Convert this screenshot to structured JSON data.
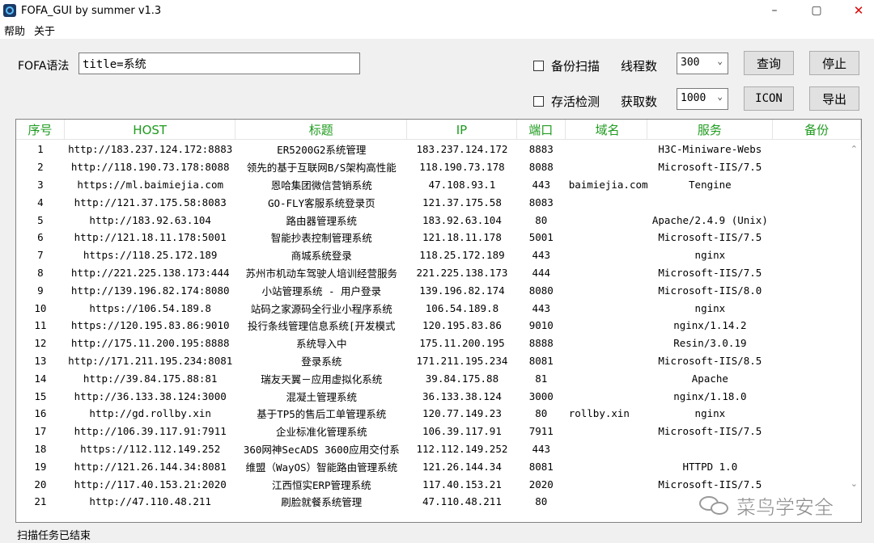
{
  "window": {
    "title": "FOFA_GUI  by summer v1.3",
    "min": "–",
    "max": "▢",
    "close": "✕"
  },
  "menu": {
    "items": [
      "帮助",
      "关于"
    ]
  },
  "query": {
    "label": "FOFA语法",
    "value": "title=系统",
    "backup_label": "备份扫描",
    "alive_label": "存活检测",
    "threads_label": "线程数",
    "threads_value": "300",
    "fetch_label": "获取数",
    "fetch_value": "1000",
    "query_btn": "查询",
    "stop_btn": "停止",
    "icon_btn": "ICON",
    "export_btn": "导出",
    "dropdown_arrow": "⌄"
  },
  "table": {
    "headers": [
      "序号",
      "HOST",
      "标题",
      "IP",
      "端口",
      "域名",
      "服务",
      "备份"
    ],
    "rows": [
      [
        "1",
        "http://183.237.124.172:8883",
        "ER5200G2系统管理",
        "183.237.124.172",
        "8883",
        "",
        "H3C-Miniware-Webs",
        ""
      ],
      [
        "2",
        "http://118.190.73.178:8088",
        "领先的基于互联网B/S架构高性能",
        "118.190.73.178",
        "8088",
        "",
        "Microsoft-IIS/7.5",
        ""
      ],
      [
        "3",
        "https://ml.baimiejia.com",
        "恩哈集团微信营销系统",
        "47.108.93.1",
        "443",
        "baimiejia.com",
        "Tengine",
        ""
      ],
      [
        "4",
        "http://121.37.175.58:8083",
        "GO-FLY客服系统登录页",
        "121.37.175.58",
        "8083",
        "",
        "",
        ""
      ],
      [
        "5",
        "http://183.92.63.104",
        "路由器管理系统",
        "183.92.63.104",
        "80",
        "",
        "Apache/2.4.9 (Unix)",
        ""
      ],
      [
        "6",
        "http://121.18.11.178:5001",
        "智能抄表控制管理系统",
        "121.18.11.178",
        "5001",
        "",
        "Microsoft-IIS/7.5",
        ""
      ],
      [
        "7",
        "https://118.25.172.189",
        "商城系统登录",
        "118.25.172.189",
        "443",
        "",
        "nginx",
        ""
      ],
      [
        "8",
        "http://221.225.138.173:444",
        "苏州市机动车驾驶人培训经营服务",
        "221.225.138.173",
        "444",
        "",
        "Microsoft-IIS/7.5",
        ""
      ],
      [
        "9",
        "http://139.196.82.174:8080",
        "小站管理系统 - 用户登录",
        "139.196.82.174",
        "8080",
        "",
        "Microsoft-IIS/8.0",
        ""
      ],
      [
        "10",
        "https://106.54.189.8",
        "站码之家源码全行业小程序系统",
        "106.54.189.8",
        "443",
        "",
        "nginx",
        ""
      ],
      [
        "11",
        "https://120.195.83.86:9010",
        "投行条线管理信息系统[开发模式",
        "120.195.83.86",
        "9010",
        "",
        "nginx/1.14.2",
        ""
      ],
      [
        "12",
        "http://175.11.200.195:8888",
        "系统导入中",
        "175.11.200.195",
        "8888",
        "",
        "Resin/3.0.19",
        ""
      ],
      [
        "13",
        "http://171.211.195.234:8081",
        "登录系统",
        "171.211.195.234",
        "8081",
        "",
        "Microsoft-IIS/8.5",
        ""
      ],
      [
        "14",
        "http://39.84.175.88:81",
        "瑞友天翼－应用虚拟化系统",
        "39.84.175.88",
        "81",
        "",
        "Apache",
        ""
      ],
      [
        "15",
        "http://36.133.38.124:3000",
        "混凝土管理系统",
        "36.133.38.124",
        "3000",
        "",
        "nginx/1.18.0",
        ""
      ],
      [
        "16",
        "http://gd.rollby.xin",
        "基于TP5的售后工单管理系统",
        "120.77.149.23",
        "80",
        "rollby.xin",
        "nginx",
        ""
      ],
      [
        "17",
        "http://106.39.117.91:7911",
        "企业标准化管理系统",
        "106.39.117.91",
        "7911",
        "",
        "Microsoft-IIS/7.5",
        ""
      ],
      [
        "18",
        "https://112.112.149.252",
        "360网神SecADS 3600应用交付系",
        "112.112.149.252",
        "443",
        "",
        "",
        ""
      ],
      [
        "19",
        "http://121.26.144.34:8081",
        "维盟（WayOS）智能路由管理系统",
        "121.26.144.34",
        "8081",
        "",
        "HTTPD  1.0",
        ""
      ],
      [
        "20",
        "http://117.40.153.21:2020",
        "江西恒实ERP管理系统",
        "117.40.153.21",
        "2020",
        "",
        "Microsoft-IIS/7.5",
        ""
      ],
      [
        "21",
        "http://47.110.48.211",
        "刷脸就餐系统管理",
        "47.110.48.211",
        "80",
        "",
        "",
        ""
      ]
    ],
    "scroll_up": "⌃",
    "scroll_down": "⌄"
  },
  "watermark": "菜鸟学安全",
  "status": "扫描任务已结束"
}
